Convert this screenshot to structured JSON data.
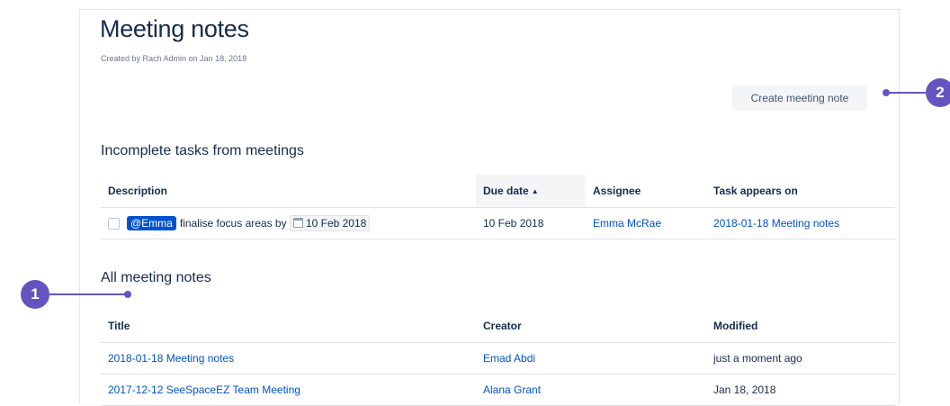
{
  "page": {
    "title": "Meeting notes",
    "byline": "Created by Rach Admin on Jan 18, 2018",
    "create_button": "Create meeting note"
  },
  "tasks_section": {
    "heading": "Incomplete tasks from meetings",
    "columns": [
      "Description",
      "Due date",
      "Assignee",
      "Task appears on"
    ],
    "sort_indicator": "▲",
    "rows": [
      {
        "mention": "@Emma",
        "text": "finalise focus areas by",
        "date": "10 Feb 2018",
        "due": "10 Feb 2018",
        "assignee": "Emma McRae",
        "appears_on": "2018-01-18 Meeting notes"
      }
    ]
  },
  "notes_section": {
    "heading": "All meeting notes",
    "columns": [
      "Title",
      "Creator",
      "Modified"
    ],
    "rows": [
      {
        "title": "2018-01-18 Meeting notes",
        "creator": "Emad Abdi",
        "modified": "just a moment ago"
      },
      {
        "title": "2017-12-12 SeeSpaceEZ Team Meeting",
        "creator": "Alana Grant",
        "modified": "Jan 18, 2018"
      }
    ]
  },
  "callouts": [
    "1",
    "2"
  ],
  "colors": {
    "link": "#0052cc",
    "mention_bg": "#0052cc",
    "callout": "#6554c0",
    "button_bg": "#f4f5f7"
  }
}
